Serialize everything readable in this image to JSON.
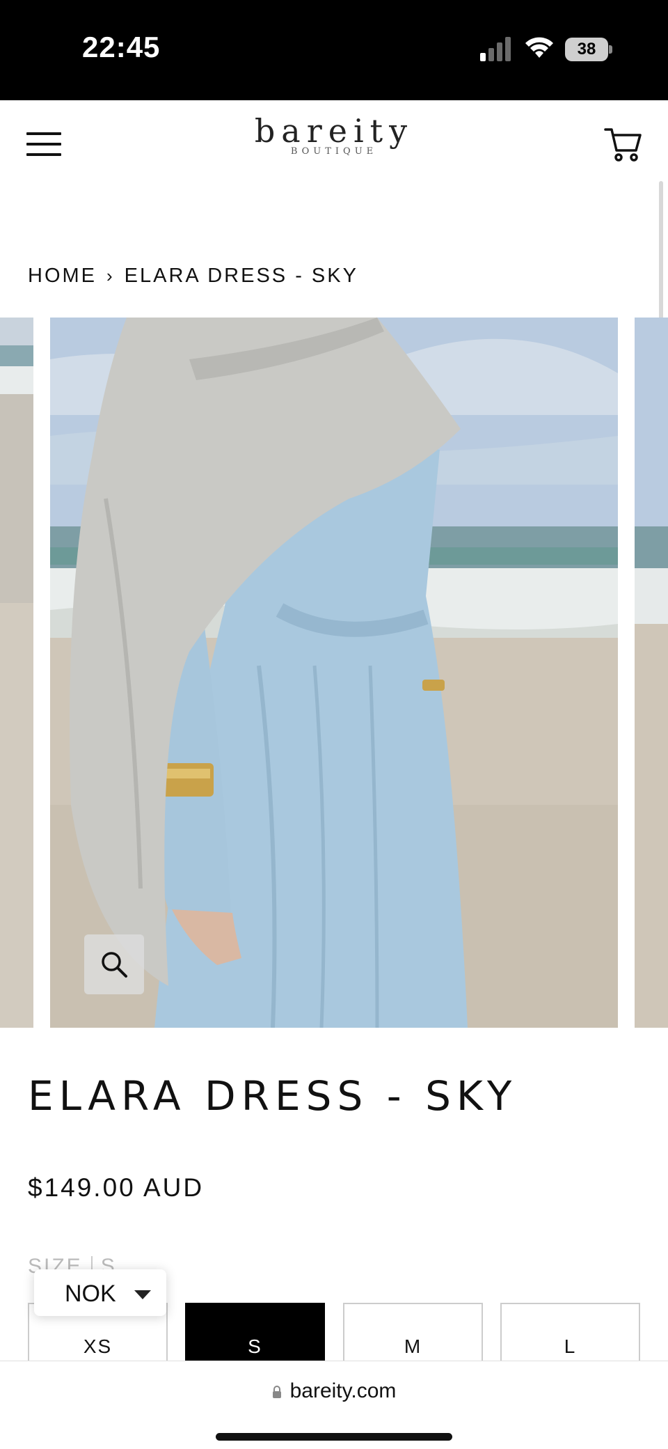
{
  "status_bar": {
    "time": "22:45",
    "battery": "38"
  },
  "header": {
    "logo_main": "bareity",
    "logo_sub": "BOUTIQUE",
    "menu_icon": "hamburger-icon",
    "cart_icon": "cart-icon"
  },
  "breadcrumb": {
    "home": "HOME",
    "separator": "›",
    "current": "ELARA DRESS - SKY"
  },
  "gallery": {
    "zoom_icon": "search-icon"
  },
  "product": {
    "title": "ELARA DRESS - SKY",
    "price": "$149.00 AUD",
    "size_label": "SIZE",
    "size_selected_label": "S",
    "sizes": [
      {
        "label": "XS",
        "selected": false
      },
      {
        "label": "S",
        "selected": true
      },
      {
        "label": "M",
        "selected": false
      },
      {
        "label": "L",
        "selected": false
      }
    ]
  },
  "currency_selector": {
    "value": "NOK"
  },
  "browser": {
    "url": "bareity.com"
  },
  "colors": {
    "accent": "#000000",
    "sky_dress": "#a9c9df",
    "scarf": "#c9c9c5",
    "sand": "#cfc6b8",
    "sea": "#7ea5ad"
  }
}
